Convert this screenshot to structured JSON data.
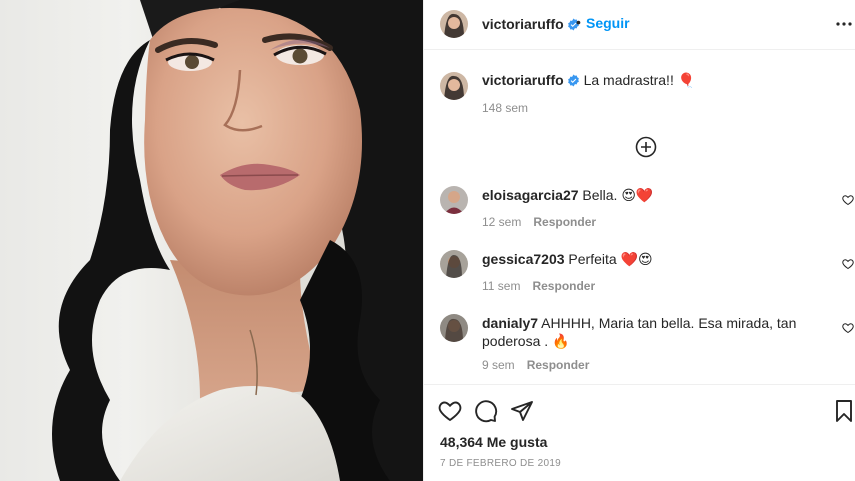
{
  "post": {
    "image_alt_icon": "portrait-photo"
  },
  "header": {
    "username": "victoriaruffo",
    "separator": "•",
    "follow_label": "Seguir"
  },
  "caption": {
    "username": "victoriaruffo",
    "text": "La madrastra!! 🎈",
    "time": "148 sem"
  },
  "comments": [
    {
      "username": "eloisagarcia27",
      "text": "Bella. 😍❤️",
      "time": "12 sem",
      "reply": "Responder"
    },
    {
      "username": "gessica7203",
      "text": "Perfeita ❤️😍",
      "time": "11 sem",
      "reply": "Responder"
    },
    {
      "username": "danialy7",
      "text": "AHHHH, Maria tan bella. Esa mirada, tan poderosa . 🔥",
      "time": "9 sem",
      "reply": "Responder"
    }
  ],
  "actions": {
    "likes": "48,364 Me gusta",
    "date": "7 DE FEBRERO DE 2019"
  },
  "colors": {
    "accent": "#0095f6",
    "verified": "#3897f0",
    "muted": "#8e8e8e",
    "text": "#262626"
  }
}
